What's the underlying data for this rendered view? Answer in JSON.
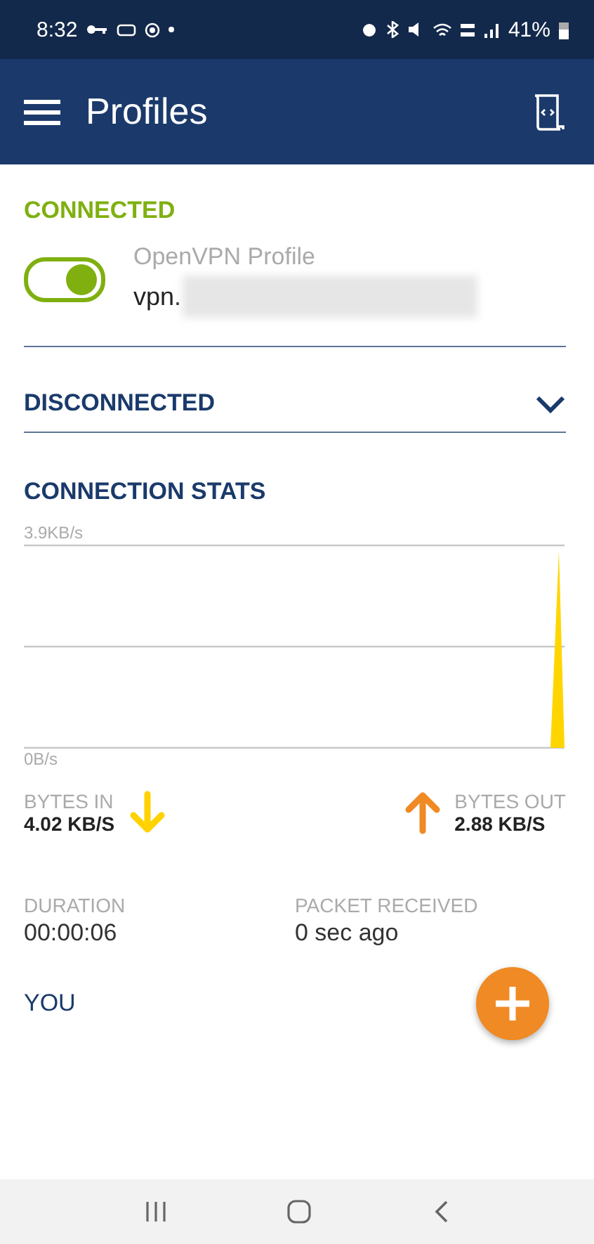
{
  "status_bar": {
    "time": "8:32",
    "battery": "41%"
  },
  "app_bar": {
    "title": "Profiles"
  },
  "connected": {
    "heading": "CONNECTED",
    "profile": {
      "on": true,
      "name": "OpenVPN Profile",
      "server": "vpn."
    }
  },
  "disconnected": {
    "heading": "DISCONNECTED",
    "expanded": false
  },
  "stats": {
    "heading": "CONNECTION STATS",
    "graph": {
      "max_label": "3.9KB/s",
      "min_label": "0B/s"
    },
    "bytes_in": {
      "label": "BYTES IN",
      "value": "4.02 KB/S"
    },
    "bytes_out": {
      "label": "BYTES OUT",
      "value": "2.88 KB/S"
    },
    "duration": {
      "label": "DURATION",
      "value": "00:00:06"
    },
    "packet": {
      "label": "PACKET RECEIVED",
      "value": "0 sec ago"
    }
  },
  "you": {
    "heading": "YOU"
  }
}
